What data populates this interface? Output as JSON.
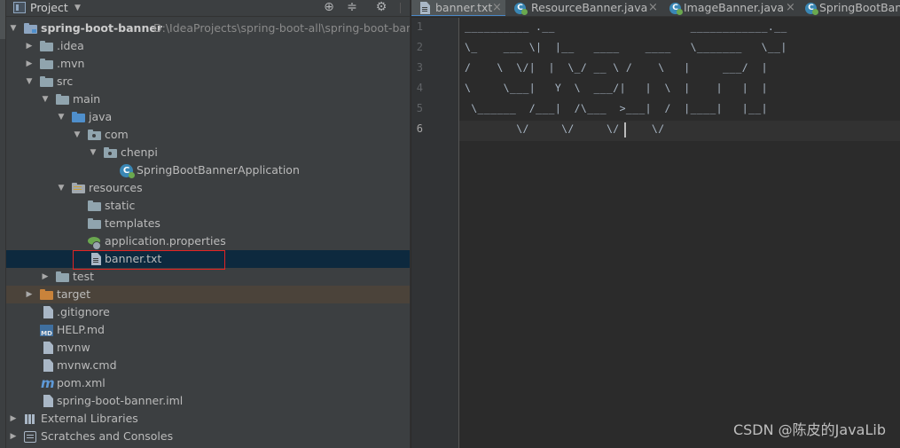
{
  "panel": {
    "title": "Project",
    "tools": {
      "locate": "⊕",
      "collapse": "≑",
      "settings": "⚙",
      "hide": "—"
    }
  },
  "tree": [
    {
      "label": "spring-boot-banner",
      "hint": "D:\\IdeaProjects\\spring-boot-all\\spring-boot-banner",
      "arrow": "▼"
    },
    {
      "label": ".idea",
      "arrow": "▶"
    },
    {
      "label": ".mvn",
      "arrow": "▶"
    },
    {
      "label": "src",
      "arrow": "▼"
    },
    {
      "label": "main",
      "arrow": "▼"
    },
    {
      "label": "java",
      "arrow": "▼"
    },
    {
      "label": "com",
      "arrow": "▼"
    },
    {
      "label": "chenpi",
      "arrow": "▼"
    },
    {
      "label": "SpringBootBannerApplication",
      "icon_letter": "C"
    },
    {
      "label": "resources",
      "arrow": "▼"
    },
    {
      "label": "static"
    },
    {
      "label": "templates"
    },
    {
      "label": "application.properties"
    },
    {
      "label": "banner.txt"
    },
    {
      "label": "test",
      "arrow": "▶"
    },
    {
      "label": "target",
      "arrow": "▶"
    },
    {
      "label": ".gitignore"
    },
    {
      "label": "HELP.md",
      "icon_letter": "MD"
    },
    {
      "label": "mvnw"
    },
    {
      "label": "mvnw.cmd"
    },
    {
      "label": "pom.xml",
      "icon_letter": "m"
    },
    {
      "label": "spring-boot-banner.iml"
    },
    {
      "label": "External Libraries",
      "arrow": "▶"
    },
    {
      "label": "Scratches and Consoles",
      "arrow": "▶"
    }
  ],
  "tabs": [
    {
      "label": "banner.txt",
      "icon_letter": "",
      "close": "×"
    },
    {
      "label": "ResourceBanner.java",
      "icon_letter": "C",
      "close": "×"
    },
    {
      "label": "ImageBanner.java",
      "icon_letter": "C",
      "close": "×"
    },
    {
      "label": "SpringBootBannerApplication.java",
      "icon_letter": "C",
      "close": ""
    }
  ],
  "editor": {
    "line_numbers": [
      "1",
      "2",
      "3",
      "4",
      "5",
      "6"
    ],
    "lines": [
      "__________ .__                     ____________.__",
      "\\_    ___ \\|  |__   ____    ____   \\_______   \\__|",
      "/    \\  \\/|  |  \\_/ __ \\ /    \\   |     ___/  |",
      "\\     \\___|   Y  \\  ___/|   |  \\  |    |   |  |",
      " \\______  /___|  /\\___  >___|  /  |____|   |__|",
      "        \\/     \\/     \\/     \\/"
    ]
  },
  "watermark": "CSDN @陈皮的JavaLib"
}
